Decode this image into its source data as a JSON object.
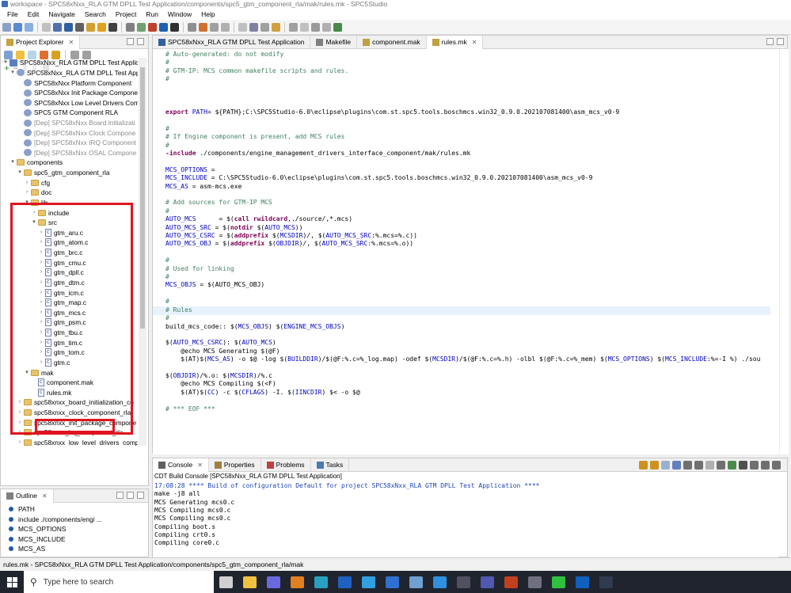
{
  "window": {
    "title": "workspace - SPC58xNxx_RLA GTM DPLL Test Application/components/spc5_gtm_component_rla/mak/rules.mk - SPC5Studio"
  },
  "menu": [
    "File",
    "Edit",
    "Navigate",
    "Search",
    "Project",
    "Run",
    "Window",
    "Help"
  ],
  "project_explorer": {
    "title": "Project Explorer",
    "tree": [
      {
        "label": "SPC58xNxx_RLA GTM DPLL Test Applicat",
        "depth": 0,
        "twisty": "▾",
        "icon": "project"
      },
      {
        "label": "SPC58xNxx_RLA GTM DPLL Test Appl",
        "depth": 1,
        "twisty": "▾",
        "icon": "gear"
      },
      {
        "label": "SPC58xNxx Platform Component",
        "depth": 2,
        "twisty": "",
        "icon": "gear"
      },
      {
        "label": "SPC58xNxx Init Package Compone",
        "depth": 2,
        "twisty": "",
        "icon": "gear"
      },
      {
        "label": "SPC58xNxx Low Level Drivers Com",
        "depth": 2,
        "twisty": "",
        "icon": "gear"
      },
      {
        "label": "SPC5 GTM Component RLA",
        "depth": 2,
        "twisty": "",
        "icon": "gear"
      },
      {
        "label": "[Dep] SPC58xNxx Board Initializati",
        "depth": 2,
        "twisty": "",
        "icon": "gear",
        "dep": true
      },
      {
        "label": "[Dep] SPC58xNxx Clock Compone",
        "depth": 2,
        "twisty": "",
        "icon": "gear",
        "dep": true
      },
      {
        "label": "[Dep] SPC58xNxx IRQ Component",
        "depth": 2,
        "twisty": "",
        "icon": "gear",
        "dep": true
      },
      {
        "label": "[Dep] SPC58xNxx OSAL Compone",
        "depth": 2,
        "twisty": "",
        "icon": "gear",
        "dep": true
      },
      {
        "label": "components",
        "depth": 1,
        "twisty": "▾",
        "icon": "folder"
      },
      {
        "label": "spc5_gtm_component_rla",
        "depth": 2,
        "twisty": "▾",
        "icon": "folder"
      },
      {
        "label": "cfg",
        "depth": 3,
        "twisty": "›",
        "icon": "folder"
      },
      {
        "label": "doc",
        "depth": 3,
        "twisty": "›",
        "icon": "folder"
      },
      {
        "label": "lib",
        "depth": 3,
        "twisty": "▾",
        "icon": "folder"
      },
      {
        "label": "include",
        "depth": 4,
        "twisty": "›",
        "icon": "folder"
      },
      {
        "label": "src",
        "depth": 4,
        "twisty": "▾",
        "icon": "folder"
      },
      {
        "label": "gtm_aru.c",
        "depth": 5,
        "twisty": "›",
        "icon": "c"
      },
      {
        "label": "gtm_atom.c",
        "depth": 5,
        "twisty": "›",
        "icon": "c"
      },
      {
        "label": "gtm_brc.c",
        "depth": 5,
        "twisty": "›",
        "icon": "c"
      },
      {
        "label": "gtm_cmu.c",
        "depth": 5,
        "twisty": "›",
        "icon": "c"
      },
      {
        "label": "gtm_dpll.c",
        "depth": 5,
        "twisty": "›",
        "icon": "c"
      },
      {
        "label": "gtm_dtm.c",
        "depth": 5,
        "twisty": "›",
        "icon": "c"
      },
      {
        "label": "gtm_icm.c",
        "depth": 5,
        "twisty": "›",
        "icon": "c"
      },
      {
        "label": "gtm_map.c",
        "depth": 5,
        "twisty": "›",
        "icon": "c"
      },
      {
        "label": "gtm_mcs.c",
        "depth": 5,
        "twisty": "›",
        "icon": "c"
      },
      {
        "label": "gtm_psm.c",
        "depth": 5,
        "twisty": "›",
        "icon": "c"
      },
      {
        "label": "gtm_tbu.c",
        "depth": 5,
        "twisty": "›",
        "icon": "c"
      },
      {
        "label": "gtm_tim.c",
        "depth": 5,
        "twisty": "›",
        "icon": "c"
      },
      {
        "label": "gtm_tom.c",
        "depth": 5,
        "twisty": "›",
        "icon": "c"
      },
      {
        "label": "gtm.c",
        "depth": 5,
        "twisty": "›",
        "icon": "c"
      },
      {
        "label": "mak",
        "depth": 3,
        "twisty": "▾",
        "icon": "folder"
      },
      {
        "label": "component.mak",
        "depth": 4,
        "twisty": "",
        "icon": "file"
      },
      {
        "label": "rules.mk",
        "depth": 4,
        "twisty": "",
        "icon": "file"
      },
      {
        "label": "spc58xnxx_board_initialization_co",
        "depth": 2,
        "twisty": "›",
        "icon": "folder"
      },
      {
        "label": "spc58xnxx_clock_component_rla",
        "depth": 2,
        "twisty": "›",
        "icon": "folder"
      },
      {
        "label": "spc58xnxx_init_package_compone",
        "depth": 2,
        "twisty": "›",
        "icon": "folder"
      },
      {
        "label": "spc58xnxx_irq_component_rla",
        "depth": 2,
        "twisty": "›",
        "icon": "folder"
      },
      {
        "label": "spc58xnxx_low_level_drivers_comp",
        "depth": 2,
        "twisty": "›",
        "icon": "folder"
      }
    ]
  },
  "outline": {
    "title": "Outline",
    "items": [
      "PATH",
      "include ./components/engi ...",
      "MCS_OPTIONS",
      "MCS_INCLUDE",
      "MCS_AS"
    ]
  },
  "editor": {
    "tabs": [
      {
        "label": "SPC58xNxx_RLA GTM DPLL Test Application",
        "active": false
      },
      {
        "label": "Makefile",
        "active": false
      },
      {
        "label": "component.mak",
        "active": false
      },
      {
        "label": "rules.mk",
        "active": true
      }
    ],
    "lines": [
      [
        [
          "cm",
          "# Auto-generated: do not modify"
        ]
      ],
      [
        [
          "cm",
          "#"
        ]
      ],
      [
        [
          "cm",
          "# GTM-IP: MCS common makefile scripts and rules."
        ]
      ],
      [
        [
          "cm",
          "#"
        ]
      ],
      [],
      [],
      [],
      [
        [
          "kw",
          "export "
        ],
        [
          "vr",
          "PATH"
        ],
        [
          "",
          "= ${PATH};C:\\SPC5Studio-6.0\\eclipse\\plugins\\com.st.spc5.tools.boschmcs.win32_0.9.0.202107081400\\asm_mcs_v0-9"
        ]
      ],
      [],
      [
        [
          "cm",
          "#"
        ]
      ],
      [
        [
          "cm",
          "# If Engine component is present, add MCS rules"
        ]
      ],
      [
        [
          "cm",
          "#"
        ]
      ],
      [
        [
          "kw",
          "-include"
        ],
        [
          "",
          " ./components/engine_management_drivers_interface_component/mak/rules.mk"
        ]
      ],
      [],
      [
        [
          "vr",
          "MCS_OPTIONS"
        ],
        [
          "",
          " ="
        ]
      ],
      [
        [
          "vr",
          "MCS_INCLUDE"
        ],
        [
          "",
          " = C:\\SPC5Studio-6.0\\eclipse\\plugins\\com.st.spc5.tools.boschmcs.win32_0.9.0.202107081400\\asm_mcs_v0-9"
        ]
      ],
      [
        [
          "vr",
          "MCS_AS"
        ],
        [
          "",
          " = asm-mcs.exe"
        ]
      ],
      [],
      [
        [
          "cm",
          "# Add sources for GTM-IP MCS"
        ]
      ],
      [
        [
          "cm",
          "#"
        ]
      ],
      [
        [
          "vr",
          "AUTO_MCS"
        ],
        [
          "",
          "      = $("
        ],
        [
          "kw",
          "call"
        ],
        [
          "",
          " "
        ],
        [
          "kw",
          "rwildcard"
        ],
        [
          "",
          ",./source/,*.mcs)"
        ]
      ],
      [
        [
          "vr",
          "AUTO_MCS_SRC"
        ],
        [
          "",
          " = $("
        ],
        [
          "kw",
          "notdir"
        ],
        [
          "",
          " $("
        ],
        [
          "vr",
          "AUTO_MCS"
        ],
        [
          "",
          "))"
        ]
      ],
      [
        [
          "vr",
          "AUTO_MCS_CSRC"
        ],
        [
          "",
          " = $("
        ],
        [
          "kw",
          "addprefix"
        ],
        [
          "",
          " $("
        ],
        [
          "vr",
          "MCSDIR"
        ],
        [
          "",
          ")/, $("
        ],
        [
          "vr",
          "AUTO_MCS_SRC"
        ],
        [
          "",
          ":%.mcs=%.c))"
        ]
      ],
      [
        [
          "vr",
          "AUTO_MCS_OBJ"
        ],
        [
          "",
          " = $("
        ],
        [
          "kw",
          "addprefix"
        ],
        [
          "",
          " $("
        ],
        [
          "vr",
          "OBJDIR"
        ],
        [
          "",
          ")/, $("
        ],
        [
          "vr",
          "AUTO_MCS_SRC"
        ],
        [
          "",
          ":%.mcs=%.o))"
        ]
      ],
      [],
      [
        [
          "cm",
          "#"
        ]
      ],
      [
        [
          "cm",
          "# Used for linking"
        ]
      ],
      [
        [
          "cm",
          "#"
        ]
      ],
      [
        [
          "vr",
          "MCS_OBJS"
        ],
        [
          "",
          " = $(AUTO_MCS_OBJ)"
        ]
      ],
      [],
      [
        [
          "cm",
          "#"
        ]
      ],
      [
        [
          "cm",
          "# Rules"
        ]
      ],
      [
        [
          "cm",
          "#"
        ]
      ],
      [
        [
          "",
          "build_mcs_code:: $("
        ],
        [
          "vr",
          "MCS_OBJS"
        ],
        [
          "",
          ") $("
        ],
        [
          "vr",
          "ENGINE_MCS_OBJS"
        ],
        [
          "",
          ")"
        ]
      ],
      [],
      [
        [
          "",
          "$("
        ],
        [
          "vr",
          "AUTO_MCS_CSRC"
        ],
        [
          "",
          "): $("
        ],
        [
          "vr",
          "AUTO_MCS"
        ],
        [
          "",
          ")"
        ]
      ],
      [
        [
          "",
          "    @echo MCS Generating $(@F)"
        ]
      ],
      [
        [
          "",
          "    $(AT)$("
        ],
        [
          "vr",
          "MCS_AS"
        ],
        [
          "",
          ") -o $@ -log $("
        ],
        [
          "vr",
          "BUILDDIR"
        ],
        [
          "",
          ")/$(@F:%.c=%_log.map) -odef $("
        ],
        [
          "vr",
          "MCSDIR"
        ],
        [
          "",
          ")/$(@F:%.c=%.h) -olbl $(@F:%.c=%_mem) $("
        ],
        [
          "vr",
          "MCS_OPTIONS"
        ],
        [
          "",
          ") $("
        ],
        [
          "vr",
          "MCS_INCLUDE"
        ],
        [
          "",
          ":%=-I %) ./sou"
        ]
      ],
      [],
      [
        [
          "",
          "$("
        ],
        [
          "vr",
          "OBJDIR"
        ],
        [
          "",
          ")/%.o: $("
        ],
        [
          "vr",
          "MCSDIR"
        ],
        [
          "",
          ")/%.c"
        ]
      ],
      [
        [
          "",
          "    @echo MCS Compiling $(<F)"
        ]
      ],
      [
        [
          "",
          "    $(AT)$("
        ],
        [
          "vr",
          "CC"
        ],
        [
          "",
          ") -c $("
        ],
        [
          "vr",
          "CFLAGS"
        ],
        [
          "",
          ") -I. $("
        ],
        [
          "vr",
          "IINCDIR"
        ],
        [
          "",
          ") $< -o $@"
        ]
      ],
      [],
      [
        [
          "cm",
          "# *** EOF ***"
        ]
      ]
    ]
  },
  "console": {
    "tabs": [
      "Console",
      "Properties",
      "Problems",
      "Tasks"
    ],
    "subtitle": "CDT Build Console [SPC58xNxx_RLA GTM DPLL Test Application]",
    "lines": [
      {
        "text": "17:08:28 **** Build of configuration Default for project SPC58xNxx_RLA GTM DPLL Test Application ****",
        "color": "#1e46b4"
      },
      {
        "text": "make -j8 all",
        "color": "#000"
      },
      {
        "text": "MCS Generating mcs0.c",
        "color": "#000"
      },
      {
        "text": "MCS Compiling mcs0.c",
        "color": "#000"
      },
      {
        "text": "MCS Compiling mcs0.c",
        "color": "#000"
      },
      {
        "text": "Compiling boot.s",
        "color": "#000"
      },
      {
        "text": "Compiling crt0.s",
        "color": "#000"
      },
      {
        "text": "Compiling core0.c",
        "color": "#000"
      }
    ]
  },
  "status_bar": {
    "text": "rules.mk - SPC58xNxx_RLA GTM DPLL Test Application/components/spc5_gtm_component_rla/mak"
  },
  "taskbar": {
    "search_placeholder": "Type here to search"
  },
  "colors": {
    "comment": "#3f7f5f",
    "keyword": "#7f0055",
    "variable": "#0000c0",
    "highlight": "#e0141e"
  }
}
